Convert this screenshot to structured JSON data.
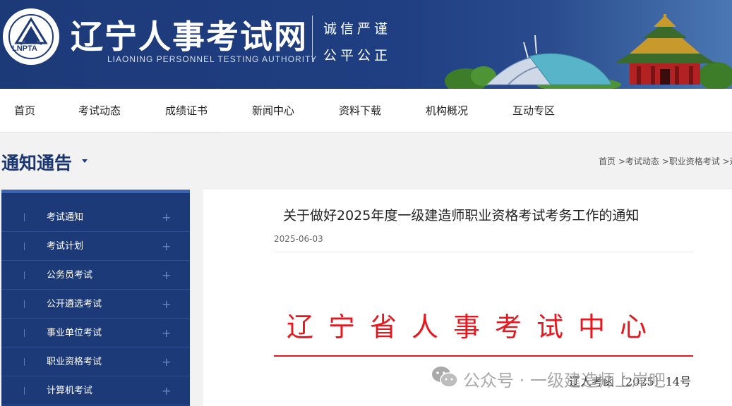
{
  "header": {
    "logo_text": "LNPTA",
    "title": "辽宁人事考试网",
    "subtitle": "LIAONING PERSONNEL TESTING AUTHORITY",
    "motto_line1": "诚信严谨",
    "motto_line2": "公平公正"
  },
  "nav": {
    "items": [
      "首页",
      "考试动态",
      "成绩证书",
      "新闻中心",
      "资料下载",
      "机构概况",
      "互动专区"
    ],
    "active_index": 2
  },
  "section": {
    "title": "通知通告"
  },
  "breadcrumb": {
    "items": [
      "首页",
      "考试动态",
      "职业资格考试",
      "通"
    ]
  },
  "sidebar": {
    "items": [
      "考试通知",
      "考试计划",
      "公务员考试",
      "公开遴选考试",
      "事业单位考试",
      "职业资格考试",
      "计算机考试"
    ],
    "expand_symbol": "+"
  },
  "article": {
    "title": "关于做好2025年度一级建造师职业资格考试考务工作的通知",
    "date": "2025-06-03",
    "org_heading": "辽宁省人事考试中心",
    "doc_number": "辽人考函〔2025〕14号"
  },
  "watermark": {
    "text": "公众号 · 一级建造师上岸吧",
    "icon": "wechat-icon"
  },
  "colors": {
    "header_blue": "#1d3a78",
    "sidebar_blue": "#1d3a78",
    "accent_red": "#e8161d",
    "title_blue": "#1b3570"
  }
}
